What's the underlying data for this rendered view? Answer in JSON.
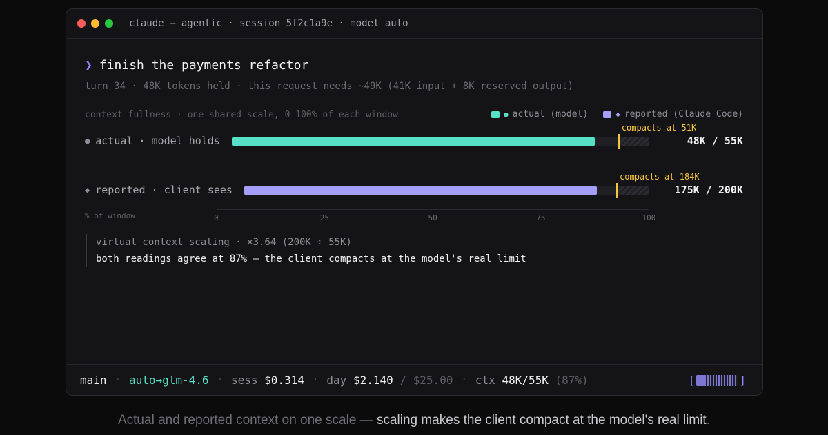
{
  "window": {
    "title": "claude — agentic · session 5f2c1a9e · model auto"
  },
  "prompt": {
    "chevron": "❯",
    "text": "finish the payments refactor"
  },
  "subline": "turn 34 · 48K tokens held · this request needs ~49K (41K input + 8K reserved output)",
  "chart_header": {
    "caption": "context fullness · one shared scale, 0–100% of each window",
    "legend": [
      {
        "mark": "●",
        "label": "actual (model)",
        "color": "#56e0c6"
      },
      {
        "mark": "◆",
        "label": "reported (Claude Code)",
        "color": "#a49ff8"
      }
    ]
  },
  "chart_data": {
    "type": "bar",
    "orientation": "horizontal",
    "xlabel": "% of window",
    "xlim": [
      0,
      100
    ],
    "ticks": [
      "0",
      "25",
      "50",
      "75",
      "100"
    ],
    "tick_values": [
      0,
      25,
      50,
      75,
      100
    ],
    "categories": [
      "actual · model holds",
      "reported · client sees"
    ],
    "bullets": [
      "●",
      "◆"
    ],
    "values": [
      87,
      87
    ],
    "colors": [
      "#56e0c6",
      "#a49ff8"
    ],
    "threshold_values": [
      92.7,
      92
    ],
    "threshold_labels": [
      "compacts at 51K",
      "compacts at 184K"
    ],
    "value_labels": [
      "48K / 55K",
      "175K / 200K"
    ]
  },
  "note": {
    "line1": "virtual context scaling · ×3.64 (200K ÷ 55K)",
    "line2": "both readings agree at 87% — the client compacts at the model's real limit"
  },
  "statusbar": {
    "branch": "main",
    "model": "auto→glm-4.6",
    "sess_label": "sess",
    "sess_value": "$0.314",
    "day_label": "day",
    "day_value": "$2.140",
    "day_limit": "/ $25.00",
    "ctx_label": "ctx",
    "ctx_value": "48K/55K",
    "ctx_pct": "(87%)",
    "gauge_open": "[",
    "gauge_close": "]",
    "gauge_fraction": 0.2
  },
  "caption": {
    "part1": "Actual and reported context on one scale — ",
    "part2": "scaling makes the client compact at the model's real limit",
    "part3": "."
  }
}
